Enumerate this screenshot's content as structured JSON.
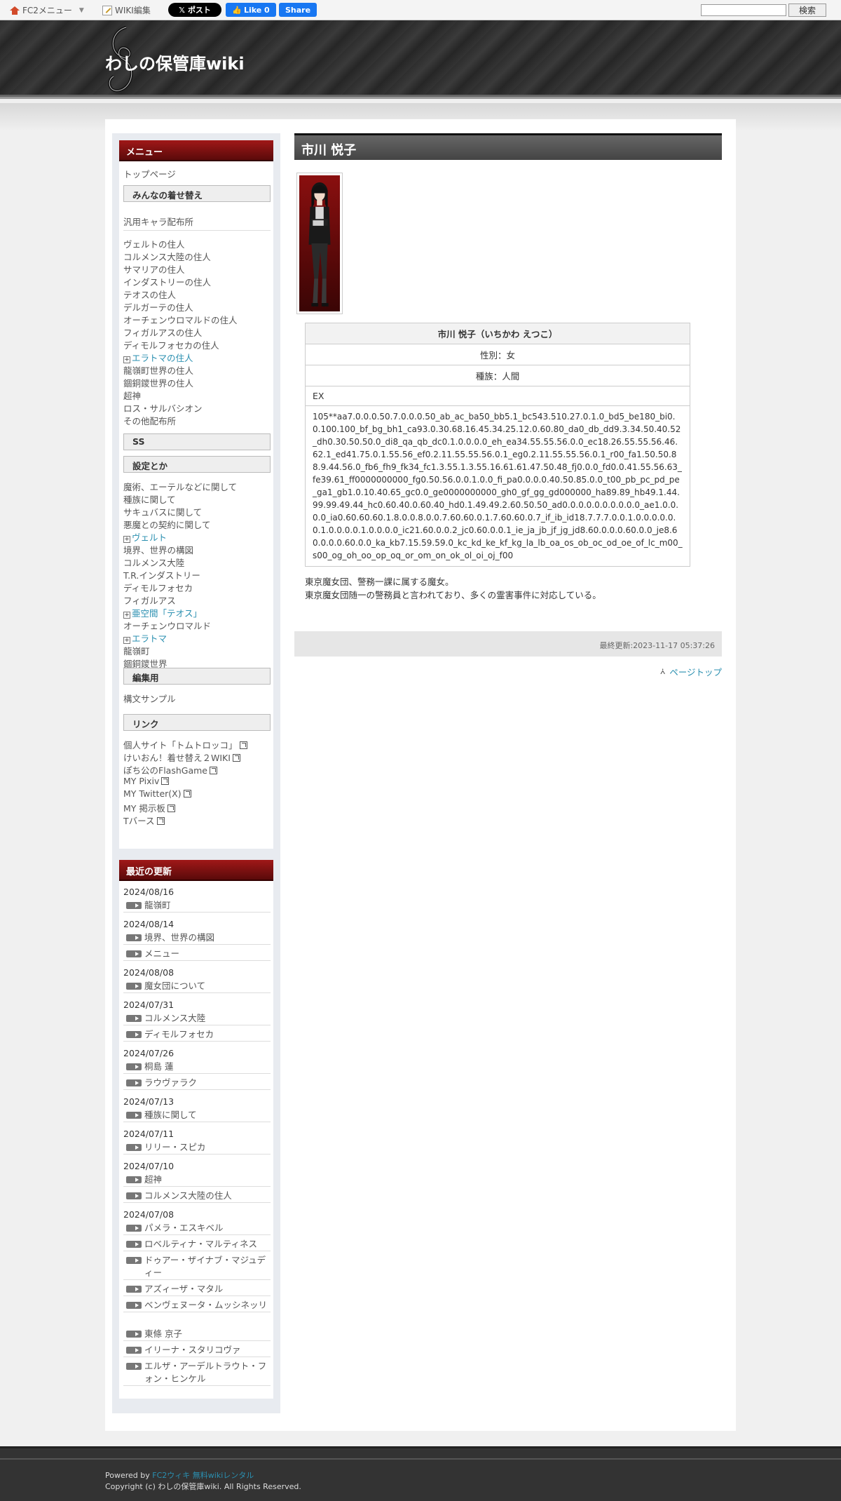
{
  "toolbar": {
    "fc2_menu": "FC2メニュー",
    "wiki_edit": "WIKI編集",
    "x_post": "ポスト",
    "fb_like": "Like 0",
    "fb_share": "Share",
    "search_button": "検索",
    "search_value": ""
  },
  "header": {
    "site_title": "わしの保管庫wiki"
  },
  "menu": {
    "title": "メニュー",
    "top_page": "トップページ",
    "section1": "みんなの着せ替え",
    "generic_chars": "汎用キャラ配布所",
    "residents": [
      "ヴェルトの住人",
      "コルメンス大陸の住人",
      "サマリアの住人",
      "インダストリーの住人",
      "テオスの住人",
      "デルガーテの住人",
      "オーチェンウロマルドの住人",
      "フィガルアスの住人",
      "ディモルフォセカの住人"
    ],
    "eratoma_residents": "エラトマの住人",
    "residents2": [
      "龍嶺町世界の住人",
      "錮銅鑁世界の住人",
      "超神",
      "ロス・サルバシオン",
      "その他配布所"
    ],
    "ss": "SS",
    "settings": "設定とか",
    "settings_items": [
      "魔術、エーテルなどに関して",
      "種族に関して",
      "サキュバスに関して",
      "悪魔との契約に関して"
    ],
    "velt": "ヴェルト",
    "settings_items2": [
      "境界、世界の構図",
      "コルメンス大陸",
      "T.R.インダストリー",
      "ディモルフォセカ",
      "フィガルアス"
    ],
    "subspace": "亜空間「テオス」",
    "ochen": "オーチェンウロマルド",
    "eratoma": "エラトマ",
    "settings_items3": [
      "龍嶺町",
      "錮銅鑁世界"
    ],
    "editing": "編集用",
    "syntax_sample": "構文サンプル",
    "links": "リンク",
    "link_items": [
      "個人サイト「トムトロッコ」",
      "けいおん！着せ替え２WIKI",
      "ぽち公のFlashGame",
      "MY Pixiv",
      "MY Twitter(X)",
      "MY 掲示板",
      "Tバース"
    ]
  },
  "recent": {
    "title": "最近の更新",
    "groups": [
      {
        "date": "2024/08/16",
        "items": [
          "龍嶺町"
        ]
      },
      {
        "date": "2024/08/14",
        "items": [
          "境界、世界の構図",
          "メニュー"
        ]
      },
      {
        "date": "2024/08/08",
        "items": [
          "魔女団について"
        ]
      },
      {
        "date": "2024/07/31",
        "items": [
          "コルメンス大陸",
          "ディモルフォセカ"
        ]
      },
      {
        "date": "2024/07/26",
        "items": [
          "桐島 蓮",
          "ラウヴァラク"
        ]
      },
      {
        "date": "2024/07/13",
        "items": [
          "種族に関して"
        ]
      },
      {
        "date": "2024/07/11",
        "items": [
          "リリー・スピカ"
        ]
      },
      {
        "date": "2024/07/10",
        "items": [
          "超神",
          "コルメンス大陸の住人"
        ]
      },
      {
        "date": "2024/07/08",
        "items": [
          "パメラ・エスキベル",
          "ロベルティナ・マルティネス",
          "ドゥアー・ザイナブ・マジュディー",
          "アズィーザ・マタル",
          "ベンヴェヌータ・ムッシネッリ",
          "東條 京子",
          "イリーナ・スタリコヴァ",
          "エルザ・アーデルトラウト・フォン・ヒンケル"
        ]
      }
    ]
  },
  "main": {
    "page_title": "市川 悦子",
    "profile_header": "市川 悦子（いちかわ えつこ）",
    "gender": "性別：女",
    "race": "種族：人間",
    "ex_label": "EX",
    "ex_code": "105**aa7.0.0.0.50.7.0.0.0.50_ab_ac_ba50_bb5.1_bc543.510.27.0.1.0_bd5_be180_bi0.0.100.100_bf_bg_bh1_ca93.0.30.68.16.45.34.25.12.0.60.80_da0_db_dd9.3.34.50.40.52_dh0.30.50.50.0_di8_qa_qb_dc0.1.0.0.0.0_eh_ea34.55.55.56.0.0_ec18.26.55.55.56.46.62.1_ed41.75.0.1.55.56_ef0.2.11.55.55.56.0.1_eg0.2.11.55.55.56.0.1_r00_fa1.50.50.88.9.44.56.0_fb6_fh9_fk34_fc1.3.55.1.3.55.16.61.61.47.50.48_fj0.0.0_fd0.0.41.55.56.63_fe39.61_ff0000000000_fg0.50.56.0.0.1.0.0_fi_pa0.0.0.0.40.50.85.0.0_t00_pb_pc_pd_pe_ga1_gb1.0.10.40.65_gc0.0_ge0000000000_gh0_gf_gg_gd000000_ha89.89_hb49.1.44.99.99.49.44_hc0.60.40.0.60.40_hd0.1.49.49.2.60.50.50_ad0.0.0.0.0.0.0.0.0.0_ae1.0.0.0.0_ia0.60.60.60.1.8.0.0.8.0.0.7.60.60.0.1.7.60.60.0.7_if_ib_id18.7.7.7.0.0.1.0.0.0.0.0.0.1.0.0.0.0.1.0.0.0.0_ic21.60.0.0.2_jc0.60.0.0.1_ie_ja_jb_jf_jg_jd8.60.0.0.0.60.0.0_je8.60.0.0.0.60.0.0_ka_kb7.15.59.59.0_kc_kd_ke_kf_kg_la_lb_oa_os_ob_oc_od_oe_of_lc_m00_s00_og_oh_oo_op_oq_or_om_on_ok_ol_oi_oj_f00",
    "desc1": "東京魔女団、警務一課に属する魔女。",
    "desc2": "東京魔女団随一の警務員と言われており、多くの霊害事件に対応している。",
    "last_modified": "最終更新:2023-11-17 05:37:26",
    "page_top": "ページトップ"
  },
  "footer": {
    "powered_by": "Powered by",
    "fc2_link": "FC2ウィキ 無料wikiレンタル",
    "copyright": "Copyright (c) わしの保管庫wiki. All Rights Reserved."
  }
}
